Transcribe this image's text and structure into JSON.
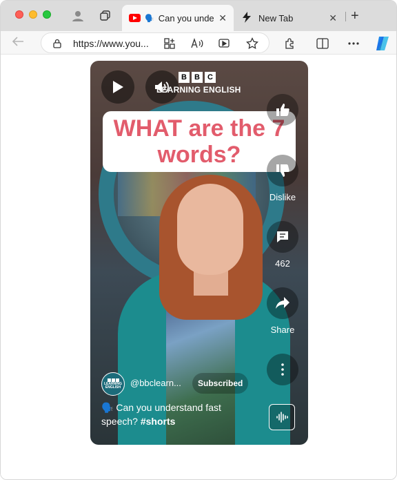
{
  "browser": {
    "tabs": [
      {
        "title": "Can you unde",
        "emoji": "🗣️",
        "active": true
      },
      {
        "title": "New Tab",
        "active": false
      }
    ],
    "url": "https://www.you...",
    "new_tab_symbol": "+",
    "close_symbol": "✕",
    "icons": [
      "profile-icon",
      "workspaces-icon",
      "youtube-favicon",
      "lightning-icon",
      "back-arrow-icon",
      "lock-icon",
      "add-to-icon",
      "read-aloud-icon",
      "media-control-icon",
      "favorite-star-icon",
      "extensions-icon",
      "split-screen-icon",
      "more-icon",
      "copilot-icon"
    ]
  },
  "video": {
    "logo_letters": [
      "B",
      "B",
      "C"
    ],
    "logo_subtitle": "LEARNING ENGLISH",
    "headline": "WHAT are the 7 words?",
    "actions": {
      "dislike_label": "Dislike",
      "comments_count": "462",
      "share_label": "Share"
    },
    "channel": {
      "name": "@bbclearn...",
      "avatar_text": "LEARNING ENGLISH",
      "subscribe_label": "Subscribed"
    },
    "caption": {
      "emoji": "🗣️",
      "text": "Can you understand fast speech?",
      "hashtag": "#shorts"
    }
  },
  "colors": {
    "headline": "#e25c6c",
    "youtube_red": "#ff0000",
    "teal": "#1c8c8e"
  }
}
